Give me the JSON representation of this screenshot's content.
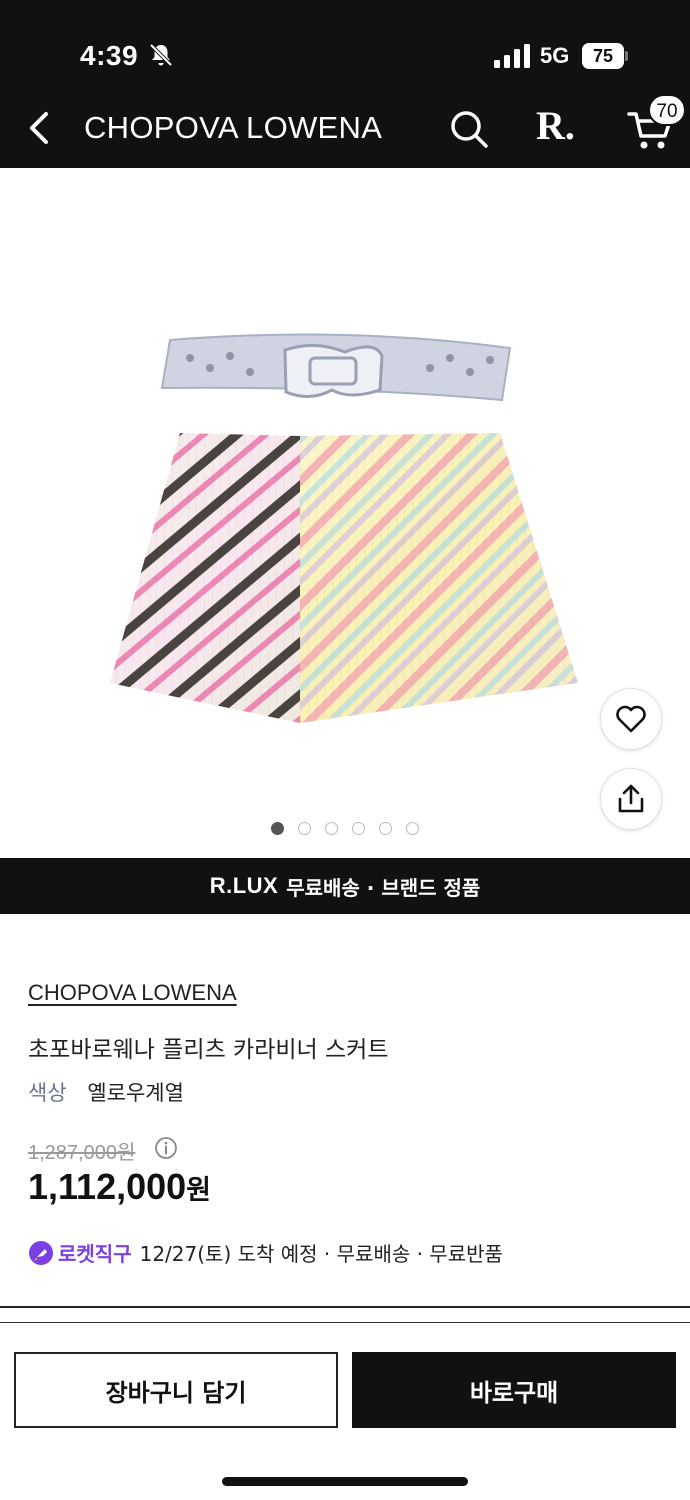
{
  "status_bar": {
    "time": "4:39",
    "network": "5G",
    "battery": "75"
  },
  "header": {
    "title": "CHOPOVA LOWENA",
    "logo": "R.",
    "cart_count": "70",
    "icons": [
      "back-icon",
      "search-icon",
      "cart-icon"
    ]
  },
  "gallery": {
    "image_count": 6,
    "active_index": 0
  },
  "banner": {
    "logo": "R.LUX",
    "text": "무료배송 · 브랜드 정품"
  },
  "product": {
    "brand": "CHOPOVA LOWENA",
    "name": "초포바로웨나 플리츠 카라비너 스커트",
    "color_label": "색상",
    "color_value": "옐로우계열",
    "original_price": "1,287,000원",
    "price_number": "1,112,000",
    "price_unit": "원",
    "delivery_badge": "로켓직구",
    "delivery_text": "12/27(토) 도착 예정 · 무료배송 · 무료반품"
  },
  "actions": {
    "add_to_cart": "장바구니 담기",
    "buy_now": "바로구매"
  },
  "colors": {
    "header_bg": "#111111",
    "rocket_accent": "#7b3fe4"
  }
}
